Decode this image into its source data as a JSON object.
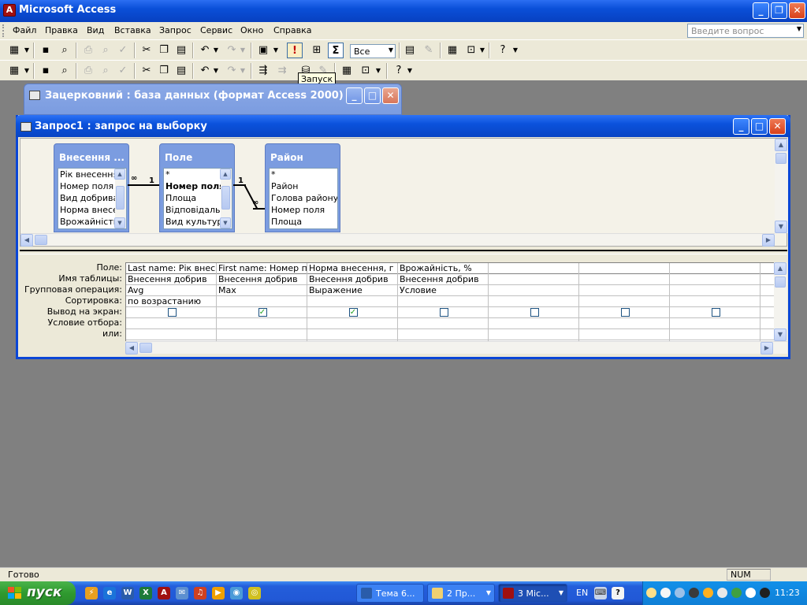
{
  "app": {
    "title": "Microsoft Access",
    "logo": "A"
  },
  "menu": {
    "items": [
      "Файл",
      "Правка",
      "Вид",
      "Вставка",
      "Запрос",
      "Сервис",
      "Окно",
      "Справка"
    ],
    "ask_placeholder": "Введите вопрос"
  },
  "toolbar": {
    "top_values_combo": "Все",
    "tooltip": "Запуск"
  },
  "db_window": {
    "title": "Зацерковний : база данных (формат Access 2000)"
  },
  "query_window": {
    "title": "Запрос1 : запрос на выборку",
    "tables": [
      {
        "name": "Внесення ...",
        "fields": [
          "Рік внесення",
          "Номер поля",
          "Вид добрива",
          "Норма внесен",
          "Врожайність,"
        ]
      },
      {
        "name": "Поле",
        "fields": [
          "*",
          "Номер поля",
          "Площа",
          "Відповідальн",
          "Вид культури"
        ]
      },
      {
        "name": "Район",
        "fields": [
          "*",
          "Район",
          "Голова району",
          "Номер поля",
          "Площа"
        ]
      }
    ],
    "relations": [
      {
        "one": "1",
        "many": "∞"
      },
      {
        "one": "1",
        "many": "∞"
      }
    ],
    "row_labels": [
      "Поле:",
      "Имя таблицы:",
      "Групповая операция:",
      "Сортировка:",
      "Вывод на экран:",
      "Условие отбора:",
      "или:"
    ],
    "columns": [
      {
        "field": "Last name: Рік внес",
        "table": "Внесення добрив",
        "group": "Avg",
        "sort": "по возрастанию",
        "show": false
      },
      {
        "field": "First name: Номер п",
        "table": "Внесення добрив",
        "group": "Max",
        "sort": "",
        "show": true
      },
      {
        "field": "Норма внесення, г",
        "table": "Внесення добрив",
        "group": "Выражение",
        "sort": "",
        "show": true
      },
      {
        "field": "Врожайність, %",
        "table": "Внесення добрив",
        "group": "Условие",
        "sort": "",
        "show": false
      },
      {
        "field": "",
        "table": "",
        "group": "",
        "sort": "",
        "show": false
      },
      {
        "field": "",
        "table": "",
        "group": "",
        "sort": "",
        "show": false
      },
      {
        "field": "",
        "table": "",
        "group": "",
        "sort": "",
        "show": false
      }
    ]
  },
  "status": {
    "text": "Готово",
    "num": "NUM"
  },
  "taskbar": {
    "start": "пуск",
    "tasks": [
      "Тема 6...",
      "2 Пр...",
      "3 Mic..."
    ],
    "lang": "EN",
    "clock": "11:23"
  },
  "colors": {
    "title_blue": "#0a4fd8",
    "start_green": "#2f9a2f",
    "access_red": "#a01010"
  }
}
